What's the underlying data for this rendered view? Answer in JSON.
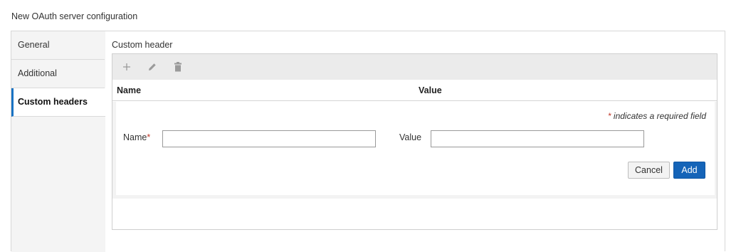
{
  "page": {
    "title": "New OAuth server configuration"
  },
  "nav": {
    "items": [
      {
        "label": "General",
        "active": false
      },
      {
        "label": "Additional",
        "active": false
      },
      {
        "label": "Custom headers",
        "active": true
      }
    ]
  },
  "section": {
    "label": "Custom header"
  },
  "toolbar": {
    "icons": [
      "add-icon",
      "edit-icon",
      "delete-icon"
    ]
  },
  "table": {
    "columns": [
      "Name",
      "Value"
    ]
  },
  "form": {
    "required_note": "indicates a required field",
    "required_marker": "*",
    "name_label": "Name",
    "name_value": "",
    "value_label": "Value",
    "value_value": "",
    "cancel_label": "Cancel",
    "add_label": "Add"
  },
  "colors": {
    "accent": "#1a73c4",
    "primary_button": "#1564b8",
    "required": "#c0392b"
  }
}
